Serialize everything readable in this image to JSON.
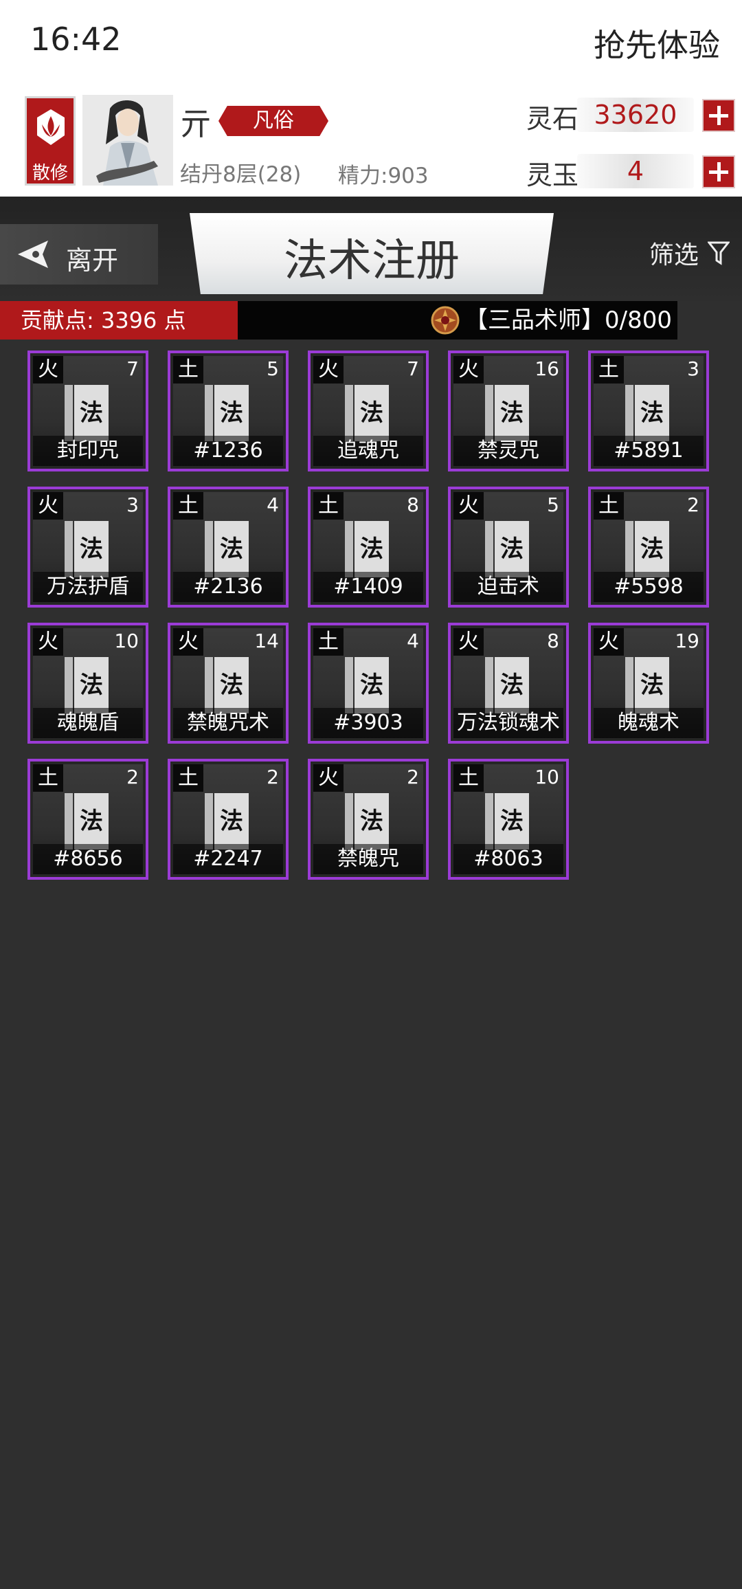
{
  "status": {
    "time": "16:42",
    "title": "抢先体验"
  },
  "profile": {
    "sect_label": "散修",
    "name": "亓",
    "rank": "凡俗",
    "realm": "结丹8层(28)",
    "energy": "精力:903"
  },
  "currencies": [
    {
      "label": "灵石",
      "value": "33620"
    },
    {
      "label": "灵玉",
      "value": "4"
    }
  ],
  "nav": {
    "leave_label": "离开",
    "page_title": "法术注册",
    "filter_label": "筛选"
  },
  "contribution": {
    "points_text": "贡献点: 3396 点",
    "grade_text": "【三品术师】0/800"
  },
  "colors": {
    "accent_red": "#b0191b",
    "card_border": "#9b3bd6"
  },
  "spells": [
    {
      "element": "火",
      "level": "7",
      "name": "封印咒"
    },
    {
      "element": "土",
      "level": "5",
      "name": "#1236"
    },
    {
      "element": "火",
      "level": "7",
      "name": "追魂咒"
    },
    {
      "element": "火",
      "level": "16",
      "name": "禁灵咒"
    },
    {
      "element": "土",
      "level": "3",
      "name": "#5891"
    },
    {
      "element": "火",
      "level": "3",
      "name": "万法护盾"
    },
    {
      "element": "土",
      "level": "4",
      "name": "#2136"
    },
    {
      "element": "土",
      "level": "8",
      "name": "#1409"
    },
    {
      "element": "火",
      "level": "5",
      "name": "迫击术"
    },
    {
      "element": "土",
      "level": "2",
      "name": "#5598"
    },
    {
      "element": "火",
      "level": "10",
      "name": "魂魄盾"
    },
    {
      "element": "火",
      "level": "14",
      "name": "禁魄咒术"
    },
    {
      "element": "土",
      "level": "4",
      "name": "#3903"
    },
    {
      "element": "火",
      "level": "8",
      "name": "万法锁魂术"
    },
    {
      "element": "火",
      "level": "19",
      "name": "魄魂术"
    },
    {
      "element": "土",
      "level": "2",
      "name": "#8656"
    },
    {
      "element": "土",
      "level": "2",
      "name": "#2247"
    },
    {
      "element": "火",
      "level": "2",
      "name": "禁魄咒"
    },
    {
      "element": "土",
      "level": "10",
      "name": "#8063"
    }
  ],
  "book_glyph": "法"
}
